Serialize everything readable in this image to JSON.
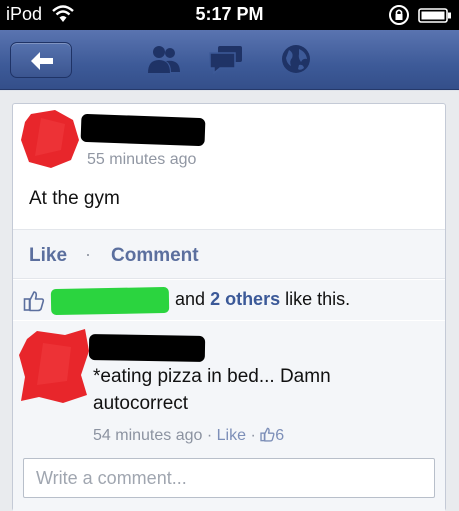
{
  "status_bar": {
    "carrier": "iPod",
    "time": "5:17 PM"
  },
  "nav": {
    "icons": [
      "back-arrow-icon",
      "friends-icon",
      "messages-icon",
      "globe-icon"
    ]
  },
  "post": {
    "time": "55 minutes ago",
    "text": "At the gym",
    "actions": {
      "like_label": "Like",
      "separator": "·",
      "comment_label": "Comment"
    },
    "likes": {
      "and_text": "and",
      "others_link": "2 others",
      "suffix": "like this."
    }
  },
  "comment": {
    "text": "*eating pizza in bed... Damn autocorrect",
    "time": "54 minutes ago",
    "sep1": "·",
    "like_label": "Like",
    "sep2": "·",
    "like_count": "6"
  },
  "comment_input": {
    "placeholder": "Write a comment..."
  },
  "colors": {
    "nav_blue": "#3d5a98",
    "link_blue": "#5b6f9e",
    "redaction_red": "#e8262b",
    "redaction_green": "#2bd43f"
  }
}
